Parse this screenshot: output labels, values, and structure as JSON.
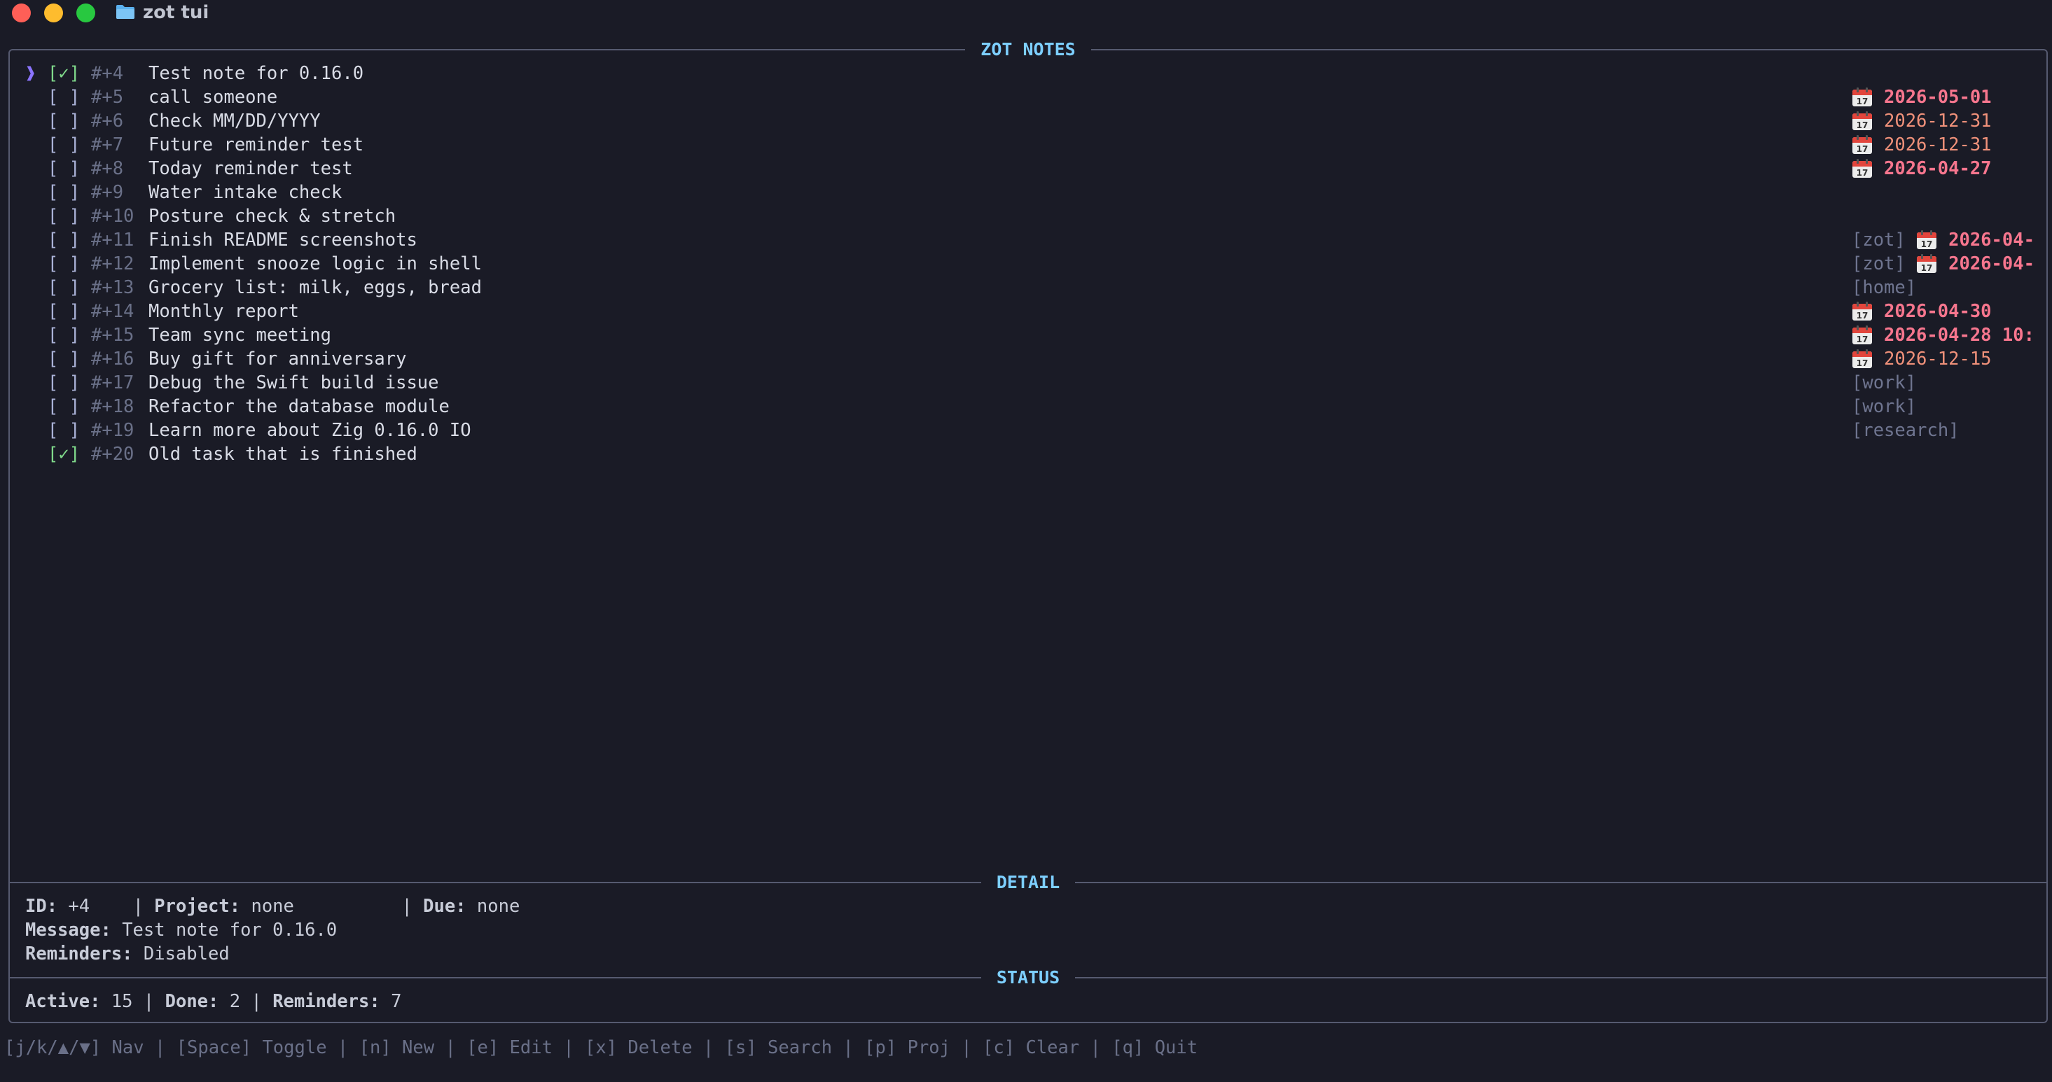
{
  "window": {
    "title": "zot tui"
  },
  "notes": {
    "title": "ZOT NOTES",
    "items": [
      {
        "selected": true,
        "check": "[✓]",
        "done": true,
        "id": "#+4",
        "text": "Test note for 0.16.0",
        "tag": "",
        "date": "",
        "date_kind": ""
      },
      {
        "selected": false,
        "check": "[ ]",
        "done": false,
        "id": "#+5",
        "text": "call someone",
        "tag": "",
        "date": "2026-05-01",
        "date_kind": "overdue"
      },
      {
        "selected": false,
        "check": "[ ]",
        "done": false,
        "id": "#+6",
        "text": "Check MM/DD/YYYY",
        "tag": "",
        "date": "2026-12-31",
        "date_kind": "future"
      },
      {
        "selected": false,
        "check": "[ ]",
        "done": false,
        "id": "#+7",
        "text": "Future reminder test",
        "tag": "",
        "date": "2026-12-31",
        "date_kind": "future"
      },
      {
        "selected": false,
        "check": "[ ]",
        "done": false,
        "id": "#+8",
        "text": "Today reminder test",
        "tag": "",
        "date": "2026-04-27",
        "date_kind": "overdue"
      },
      {
        "selected": false,
        "check": "[ ]",
        "done": false,
        "id": "#+9",
        "text": "Water intake check",
        "tag": "",
        "date": "",
        "date_kind": ""
      },
      {
        "selected": false,
        "check": "[ ]",
        "done": false,
        "id": "#+10",
        "text": "Posture check & stretch",
        "tag": "",
        "date": "",
        "date_kind": ""
      },
      {
        "selected": false,
        "check": "[ ]",
        "done": false,
        "id": "#+11",
        "text": "Finish README screenshots",
        "tag": "[zot]",
        "date": "2026-04-",
        "date_kind": "overdue"
      },
      {
        "selected": false,
        "check": "[ ]",
        "done": false,
        "id": "#+12",
        "text": "Implement snooze logic in shell",
        "tag": "[zot]",
        "date": "2026-04-",
        "date_kind": "overdue"
      },
      {
        "selected": false,
        "check": "[ ]",
        "done": false,
        "id": "#+13",
        "text": "Grocery list: milk, eggs, bread",
        "tag": "[home]",
        "date": "",
        "date_kind": ""
      },
      {
        "selected": false,
        "check": "[ ]",
        "done": false,
        "id": "#+14",
        "text": "Monthly report",
        "tag": "",
        "date": "2026-04-30",
        "date_kind": "overdue"
      },
      {
        "selected": false,
        "check": "[ ]",
        "done": false,
        "id": "#+15",
        "text": "Team sync meeting",
        "tag": "",
        "date": "2026-04-28 10:",
        "date_kind": "overdue"
      },
      {
        "selected": false,
        "check": "[ ]",
        "done": false,
        "id": "#+16",
        "text": "Buy gift for anniversary",
        "tag": "",
        "date": "2026-12-15",
        "date_kind": "future"
      },
      {
        "selected": false,
        "check": "[ ]",
        "done": false,
        "id": "#+17",
        "text": "Debug the Swift build issue",
        "tag": "[work]",
        "date": "",
        "date_kind": ""
      },
      {
        "selected": false,
        "check": "[ ]",
        "done": false,
        "id": "#+18",
        "text": "Refactor the database module",
        "tag": "[work]",
        "date": "",
        "date_kind": ""
      },
      {
        "selected": false,
        "check": "[ ]",
        "done": false,
        "id": "#+19",
        "text": "Learn more about Zig 0.16.0 IO",
        "tag": "[research]",
        "date": "",
        "date_kind": ""
      },
      {
        "selected": false,
        "check": "[✓]",
        "done": true,
        "id": "#+20",
        "text": "Old task that is finished",
        "tag": "",
        "date": "",
        "date_kind": ""
      }
    ]
  },
  "detail": {
    "title": "DETAIL",
    "id_label": "ID:",
    "id_value": "+4",
    "project_label": "Project:",
    "project_value": "none",
    "due_label": "Due:",
    "due_value": "none",
    "message_label": "Message:",
    "message_value": "Test note for 0.16.0",
    "reminders_label": "Reminders:",
    "reminders_value": "Disabled"
  },
  "status": {
    "title": "STATUS",
    "active_label": "Active:",
    "active_value": "15",
    "done_label": "Done:",
    "done_value": "2",
    "reminders_label": "Reminders:",
    "reminders_value": "7"
  },
  "footer": {
    "keybindings": "[j/k/▲/▼] Nav | [Space] Toggle | [n] New | [e] Edit | [x] Delete | [s] Search | [p] Proj | [c] Clear | [q] Quit"
  },
  "colors": {
    "background": "#1a1b26",
    "accent_title": "#7dcfff",
    "cursor": "#8b74ff",
    "done_check": "#7fd88a",
    "date_overdue": "#f7768e",
    "date_future": "#f0917a"
  }
}
